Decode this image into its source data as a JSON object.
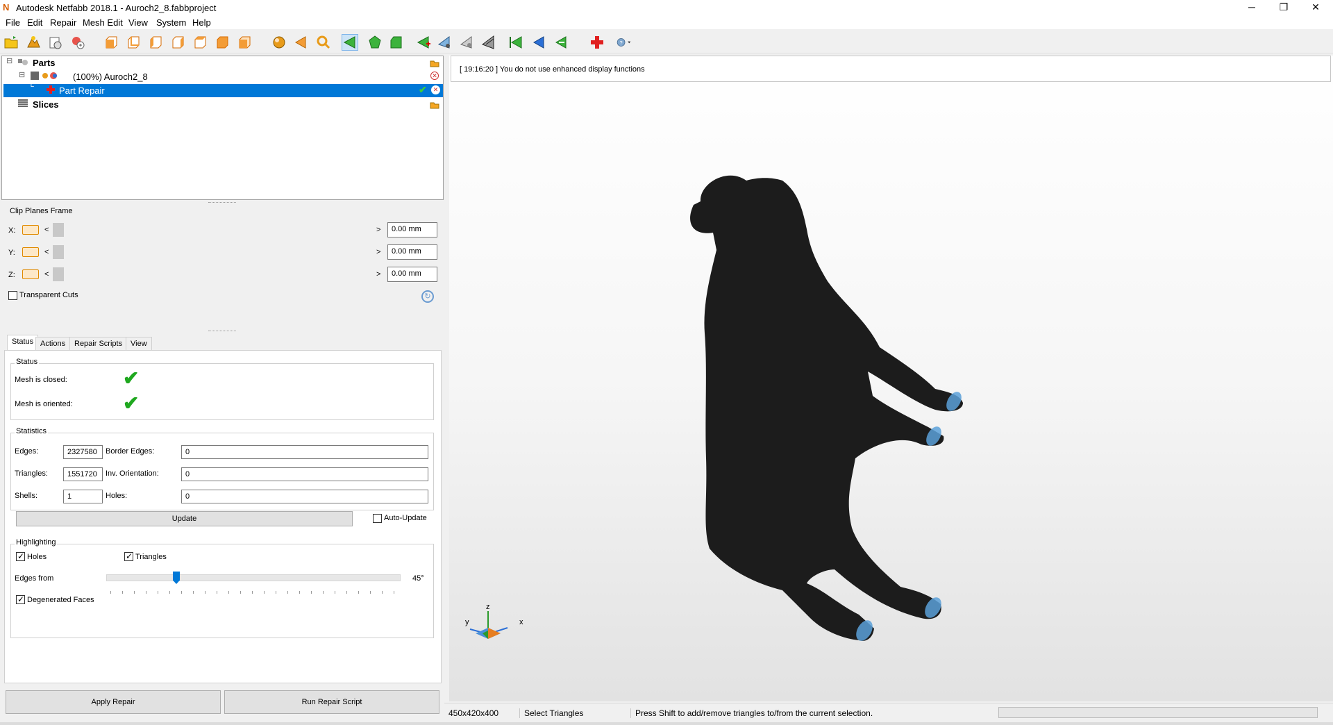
{
  "window": {
    "app_icon": "N",
    "title": "Autodesk Netfabb 2018.1 - Auroch2_8.fabbproject",
    "minimize": "─",
    "maximize": "❐",
    "close": "✕"
  },
  "menu": [
    "File",
    "Edit",
    "Repair",
    "Mesh Edit",
    "View",
    "System",
    "Help"
  ],
  "toolbar": {
    "icons": [
      "open-icon",
      "add-part-icon",
      "export-icon",
      "add-shape-icon",
      "view-front-icon",
      "view-back-icon",
      "view-left-icon",
      "view-right-icon",
      "view-top-icon",
      "view-bottom-icon",
      "view-iso-icon",
      "sphere-icon",
      "back-arrow-icon",
      "zoom-icon",
      "select-triangles-icon",
      "select-shells-icon",
      "select-surfaces-icon",
      "add-triangle-icon",
      "cut-icon",
      "knife-icon",
      "flip-icon",
      "previous-icon",
      "next-icon",
      "last-icon",
      "repair-icon",
      "help-icon"
    ]
  },
  "tree": {
    "parts_label": "Parts",
    "part_label": "(100%) Auroch2_8",
    "repair_label": "Part Repair",
    "slices_label": "Slices",
    "expand_minus": "−"
  },
  "clip": {
    "title": "Clip Planes Frame",
    "axes": [
      {
        "label": "X:",
        "value": "0.00 mm"
      },
      {
        "label": "Y:",
        "value": "0.00 mm"
      },
      {
        "label": "Z:",
        "value": "0.00 mm"
      }
    ],
    "left_arrow": "<",
    "right_arrow": ">",
    "transparent_cuts": "Transparent Cuts"
  },
  "tabs": [
    "Status",
    "Actions",
    "Repair Scripts",
    "View"
  ],
  "status": {
    "title": "Status",
    "closed_label": "Mesh is closed:",
    "oriented_label": "Mesh is oriented:",
    "check_glyph": "✔"
  },
  "statistics": {
    "title": "Statistics",
    "edges_label": "Edges:",
    "edges": "2327580",
    "border_edges_label": "Border Edges:",
    "border_edges": "0",
    "triangles_label": "Triangles:",
    "triangles": "1551720",
    "inv_orientation_label": "Inv. Orientation:",
    "inv_orientation": "0",
    "shells_label": "Shells:",
    "shells": "1",
    "holes_label": "Holes:",
    "holes": "0",
    "update_button": "Update",
    "auto_update": "Auto-Update"
  },
  "highlighting": {
    "title": "Highlighting",
    "holes": "Holes",
    "triangles": "Triangles",
    "edges_from": "Edges from",
    "angle": "45°",
    "angle_fraction": 0.23,
    "degenerated": "Degenerated Faces"
  },
  "buttons": {
    "apply_repair": "Apply Repair",
    "run_repair_script": "Run Repair Script"
  },
  "viewport": {
    "log_message": "[ 19:16:20 ] You do not use enhanced display functions",
    "model_color": "#1c1c1c",
    "hoof_color": "#5aa0d8",
    "axis_z": "z",
    "axis_y": "y",
    "axis_x": "x"
  },
  "statusbar": {
    "dimensions": "450x420x400",
    "mode": "Select Triangles",
    "hint": "Press Shift to add/remove triangles to/from the current selection."
  },
  "colors": {
    "selection": "#0078d7",
    "accent_orange": "#e08a00"
  }
}
